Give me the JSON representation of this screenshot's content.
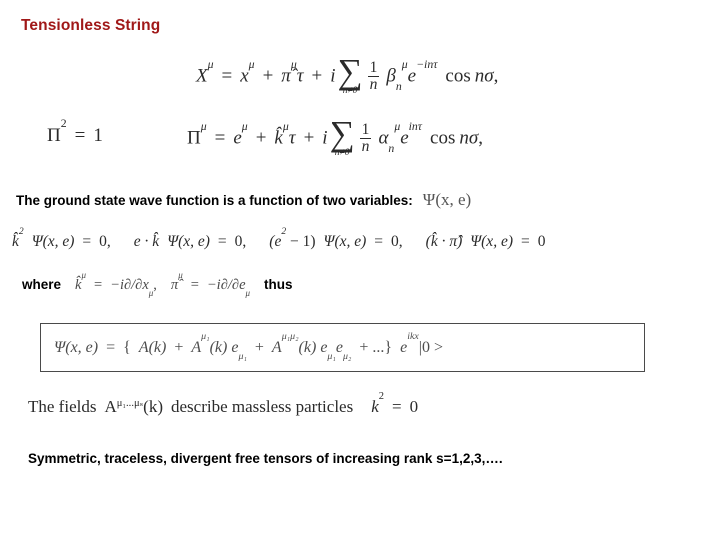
{
  "slide": {
    "title": "Tensionless String",
    "title_color": "#a01818",
    "background": "#ffffff"
  },
  "equations": {
    "mode_expansion_X": {
      "lhs": "X",
      "lhs_sup": "μ",
      "eq": "=",
      "term1": "x",
      "term1_sup": "μ",
      "plus1": "+",
      "term2": "π̂",
      "term2_sup": "μ",
      "term2_var": "τ",
      "plus2": "+",
      "imaginary": "i",
      "sum_symbol": "∑",
      "sum_limit": "n≠0",
      "frac_num": "1",
      "frac_den": "n",
      "coeff": "β",
      "coeff_sub": "n",
      "coeff_sup": "μ",
      "exp_base": "e",
      "exp_power": "−inτ",
      "trig": "cos",
      "trig_arg": "nσ",
      "trailing": ","
    },
    "pi_squared": {
      "lhs": "Π",
      "lhs_sup": "2",
      "eq": "=",
      "rhs": "1"
    },
    "mode_expansion_Pi": {
      "lhs": "Π",
      "lhs_sup": "μ",
      "eq": "=",
      "term1": "e",
      "term1_sup": "μ",
      "plus1": "+",
      "term2": "k̂",
      "term2_sup": "μ",
      "term2_var": "τ",
      "plus2": "+",
      "imaginary": "i",
      "sum_symbol": "∑",
      "sum_limit": "n≠0",
      "frac_num": "1",
      "frac_den": "n",
      "coeff": "α",
      "coeff_sub": "n",
      "coeff_sup": "μ",
      "exp_base": "e",
      "exp_power": "inτ",
      "trig": "cos",
      "trig_arg": "nσ",
      "trailing": ","
    }
  },
  "ground_state": {
    "text": "The ground state wave function is a function of two variables:",
    "wave_function": "Ψ(x, e)"
  },
  "constraints": [
    {
      "operator": "k̂",
      "operator_sup": "2",
      "psi": "Ψ(x, e)",
      "eq": "=",
      "value": "0",
      "trailing": ","
    },
    {
      "operator": "e · k̂",
      "operator_sup": "",
      "psi": "Ψ(x, e)",
      "eq": "=",
      "value": "0",
      "trailing": ","
    },
    {
      "operator": "(e",
      "operator_sup": "2",
      "operator_tail": " − 1)",
      "psi": "Ψ(x, e)",
      "eq": "=",
      "value": "0",
      "trailing": ","
    },
    {
      "operator": "(k̂ · π̂)",
      "operator_sup": "",
      "psi": "Ψ(x, e)",
      "eq": "=",
      "value": "0",
      "trailing": ""
    }
  ],
  "where_line": {
    "where_label": "where",
    "def1_lhs": "k̂",
    "def1_lhs_sup": "μ",
    "def1_eq": "=",
    "def1_rhs": "−i∂/∂x",
    "def1_rhs_sub": "μ",
    "def1_trailing": ",",
    "def2_lhs": "π̂",
    "def2_lhs_sup": "μ",
    "def2_eq": "=",
    "def2_rhs": "−i∂/∂e",
    "def2_rhs_sub": "μ",
    "thus_label": "thus"
  },
  "boxed_equation": {
    "lhs": "Ψ(x, e)",
    "eq": "=",
    "open_brace": "{",
    "t1": "A(k)",
    "plus1": "+",
    "t2_field": "A",
    "t2_sup": "μ₁",
    "t2_arg": "(k)",
    "t2_e": "e",
    "t2_e_sub": "μ₁",
    "plus2": "+",
    "t3_field": "A",
    "t3_sup": "μ₁μ₂",
    "t3_arg": "(k)",
    "t3_e1": "e",
    "t3_e1_sub": "μ₁",
    "t3_e2": "e",
    "t3_e2_sub": "μ₂",
    "plus3": "+",
    "ellipsis": "...",
    "close_brace": "}",
    "plane_wave": "e",
    "plane_wave_sup": "ikx",
    "ket": "|0 >"
  },
  "fields_line": {
    "prefix": "The fields",
    "field": "A",
    "field_sup": "μ₁...μₛ",
    "field_arg": "(k)",
    "description": "describe massless particles",
    "mass_shell_lhs": "k",
    "mass_shell_sup": "2",
    "mass_shell_eq": "=",
    "mass_shell_rhs": "0"
  },
  "bottom_line": {
    "text": "Symmetric, traceless, divergent free tensors of increasing rank s=1,2,3,…."
  }
}
